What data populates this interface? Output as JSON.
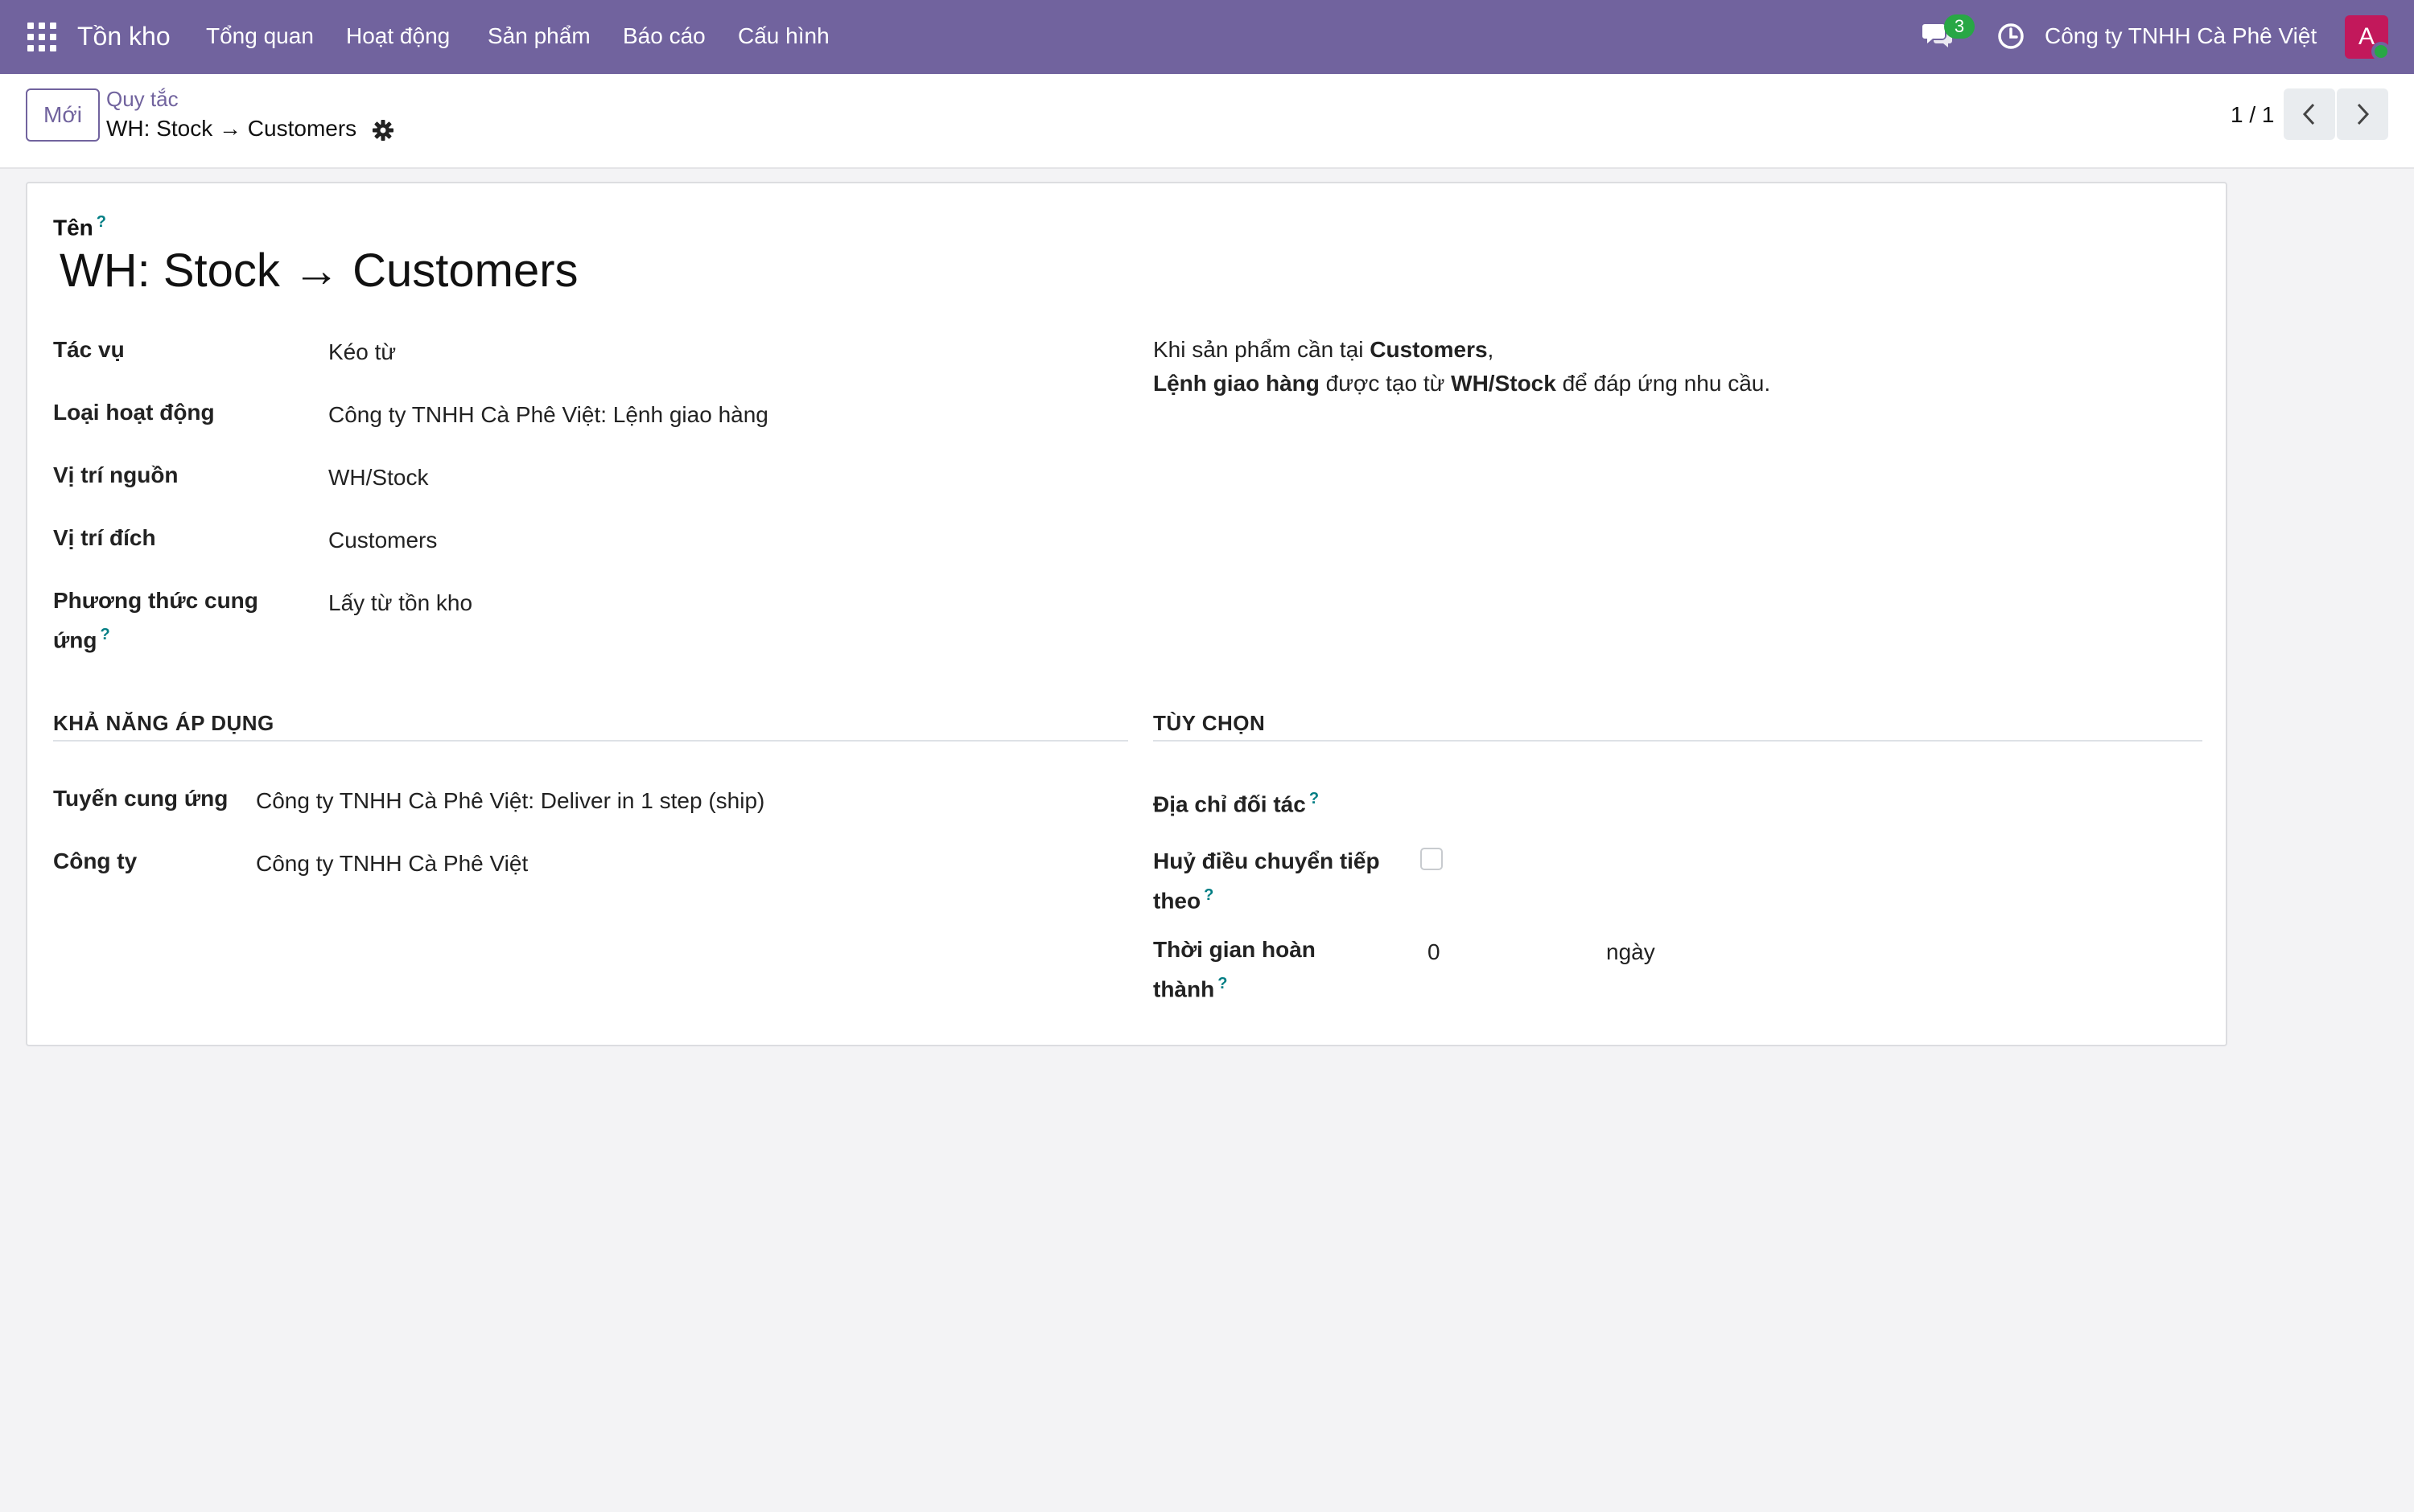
{
  "navbar": {
    "app_title": "Tồn kho",
    "menu": [
      "Tổng quan",
      "Hoạt động",
      "Sản phẩm",
      "Báo cáo",
      "Cấu hình"
    ],
    "message_count": "3",
    "company": "Công ty TNHH Cà Phê Việt",
    "avatar_letter": "A",
    "brand_color": "#71639e"
  },
  "control": {
    "new_button": "Mới",
    "breadcrumb_parent": "Quy tắc",
    "breadcrumb_current": "WH: Stock → Customers",
    "pager": "1 / 1"
  },
  "form": {
    "name_label": "Tên",
    "help_mark": "?",
    "name_value": "WH: Stock → Customers",
    "fields": {
      "action": {
        "label": "Tác vụ",
        "value": "Kéo từ"
      },
      "operation_type": {
        "label": "Loại hoạt động",
        "value": "Công ty TNHH Cà Phê Việt: Lệnh giao hàng"
      },
      "source_location": {
        "label": "Vị trí nguồn",
        "value": "WH/Stock"
      },
      "dest_location": {
        "label": "Vị trí đích",
        "value": "Customers"
      },
      "supply_method": {
        "label_line1": "Phương thức cung",
        "label_line2": "ứng",
        "value": "Lấy từ tồn kho"
      }
    },
    "description": {
      "p1_text": "Khi sản phẩm cần tại ",
      "p1_bold": "Customers",
      "p1_end": ",",
      "p2_bold1": "Lệnh giao hàng",
      "p2_text1": " được tạo từ ",
      "p2_bold2": "WH/Stock",
      "p2_text2": " để đáp ứng nhu cầu."
    },
    "applicability": {
      "title": "KHẢ NĂNG ÁP DỤNG",
      "route_label": "Tuyến cung ứng",
      "route_value": "Công ty TNHH Cà Phê Việt: Deliver in 1 step (ship)",
      "company_label": "Công ty",
      "company_value": "Công ty TNHH Cà Phê Việt"
    },
    "options": {
      "title": "TÙY CHỌN",
      "partner_label": "Địa chỉ đối tác",
      "cancel_label_line1": "Huỷ điều chuyển tiếp",
      "cancel_label_line2": "theo",
      "cancel_checked": false,
      "lead_label_line1": "Thời gian hoàn",
      "lead_label_line2": "thành",
      "lead_value": "0",
      "lead_unit": "ngày"
    }
  }
}
